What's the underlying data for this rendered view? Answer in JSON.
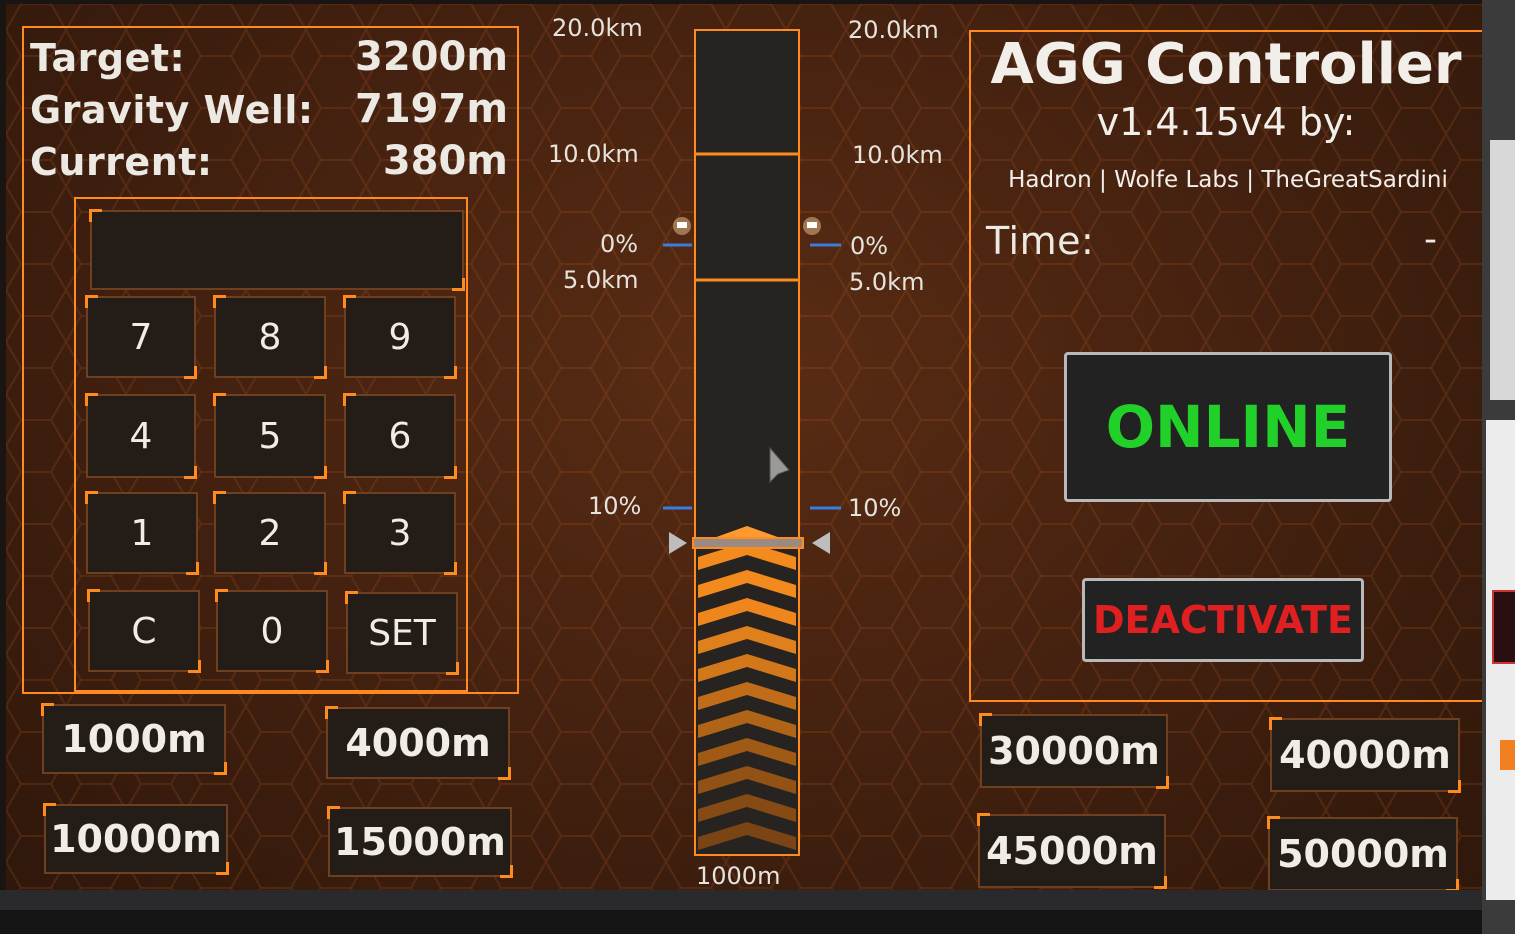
{
  "status_panel": {
    "target_label": "Target:",
    "target_value": "3200m",
    "gravity_label": "Gravity Well:",
    "gravity_value": "7197m",
    "current_label": "Current:",
    "current_value": "380m"
  },
  "keypad": {
    "display_value": "",
    "keys": [
      "7",
      "8",
      "9",
      "4",
      "5",
      "6",
      "1",
      "2",
      "3",
      "C",
      "0",
      "SET"
    ]
  },
  "presets_left": [
    "1000m",
    "4000m",
    "10000m",
    "15000m"
  ],
  "presets_right": [
    "30000m",
    "40000m",
    "45000m",
    "50000m"
  ],
  "altitude_scale": {
    "top_label": "20.0km",
    "mid_label": "10.0km",
    "low_label": "5.0km",
    "upper_percent": "0%",
    "lower_percent": "10%",
    "bottom_label": "1000m",
    "bar_fill_fraction": 0.38
  },
  "info": {
    "title": "AGG Controller",
    "version": "v1.4.15v4 by:",
    "authors": "Hadron | Wolfe Labs | TheGreatSardini",
    "time_label": "Time:",
    "time_value": "-"
  },
  "controls": {
    "online_label": "ONLINE",
    "deactivate_label": "DEACTIVATE"
  },
  "colors": {
    "accent": "#ff8a1e",
    "online": "#22d02a",
    "deactivate": "#e02020",
    "marker": "#3a7de0"
  }
}
